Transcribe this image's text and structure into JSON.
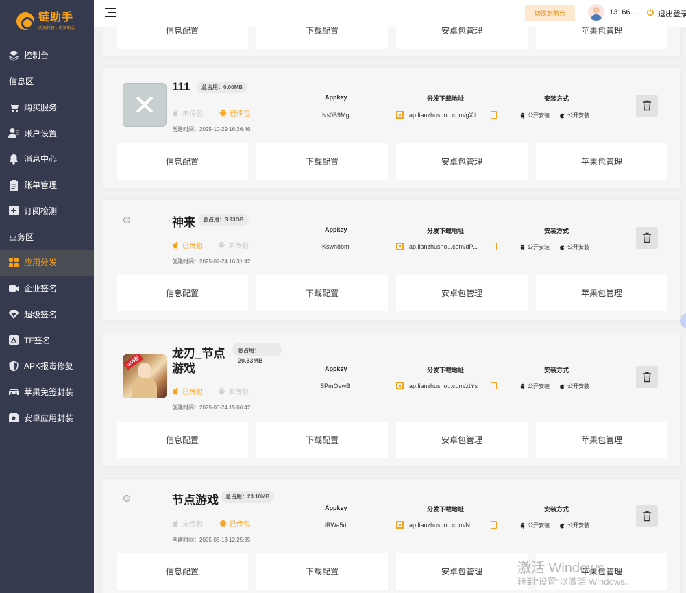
{
  "brand": {
    "name": "链助手",
    "slogan": "内测托管 · 内测助手",
    "color": "#f7a21b"
  },
  "header": {
    "switch_label": "切换到前台",
    "username": "13166...",
    "logout_label": "退出登录"
  },
  "sidebar": {
    "items": [
      {
        "type": "item",
        "label": "控制台",
        "icon": "layers-icon"
      },
      {
        "type": "section",
        "label": "信息区"
      },
      {
        "type": "item",
        "label": "购买服务",
        "icon": "cart-icon"
      },
      {
        "type": "item",
        "label": "账户设置",
        "icon": "user-settings-icon"
      },
      {
        "type": "item",
        "label": "消息中心",
        "icon": "bell-icon"
      },
      {
        "type": "item",
        "label": "账单管理",
        "icon": "clipboard-icon"
      },
      {
        "type": "item",
        "label": "订阅检测",
        "icon": "plus-box-icon"
      },
      {
        "type": "section",
        "label": "业务区"
      },
      {
        "type": "item",
        "label": "应用分发",
        "icon": "grid-icon",
        "active": true
      },
      {
        "type": "item",
        "label": "企业签名",
        "icon": "video-icon"
      },
      {
        "type": "item",
        "label": "超级签名",
        "icon": "diamond-icon"
      },
      {
        "type": "item",
        "label": "TF签名",
        "icon": "tf-icon"
      },
      {
        "type": "item",
        "label": "APK报毒修复",
        "icon": "shield-icon"
      },
      {
        "type": "item",
        "label": "苹果免签封装",
        "icon": "car-icon"
      },
      {
        "type": "item",
        "label": "安卓应用封装",
        "icon": "package-icon"
      }
    ]
  },
  "labels": {
    "appkey": "Appkey",
    "download_url": "分发下载地址",
    "install_method": "安装方式",
    "public_install": "公开安装",
    "uploaded": "已传包",
    "not_uploaded": "未传包",
    "actions": [
      "信息配置",
      "下载配置",
      "安卓包管理",
      "苹果包管理"
    ]
  },
  "apps": [
    {
      "name": "111",
      "size": "总占用：0.00MB",
      "ios_status": "未传包",
      "android_status": "已传包",
      "created": "创建时间：2025-10-29 16:26:46",
      "appkey": "Ns0B9Mg",
      "url": "ap.lianzhushou.com/gXIl",
      "icon": "x-logo-icon"
    },
    {
      "name": "神来",
      "size": "总占用：3.93GB",
      "ios_status": "已传包",
      "android_status": "未传包",
      "created": "创建时间：2025-07-24 16:31:42",
      "appkey": "Kswh8bm",
      "url": "ap.lianzhushou.com/dP...",
      "icon": "broken-image-icon"
    },
    {
      "name": "龙刃_节点游戏",
      "name_line1": "龙刃_节点",
      "name_line2": "游戏",
      "size_line1": "总占用：",
      "size_line2": "20.33MB",
      "ios_status": "已传包",
      "android_status": "未传包",
      "created": "创建时间：2025-06-24 15:06:42",
      "appkey": "5PmOewB",
      "url": "ap.lianzhushou.com/ztYs",
      "icon": "game-character-icon",
      "badge": "0.05折"
    },
    {
      "name": "节点游戏",
      "size": "总占用：23.10MB",
      "ios_status": "未传包",
      "android_status": "已传包",
      "created": "创建时间：2025-03-13 12:25:35",
      "appkey": "iRWa5ri",
      "url": "ap.lianzhushou.com/N...",
      "icon": "broken-image-icon"
    }
  ],
  "watermark": {
    "line1": "激活 Windows",
    "line2": "转到\"设置\"以激活 Windows。"
  }
}
